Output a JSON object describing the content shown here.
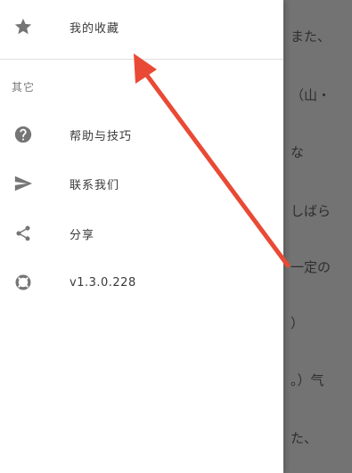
{
  "drawer": {
    "favorites_label": "我的收藏",
    "section_other": "其它",
    "items": [
      {
        "label": "帮助与技巧",
        "icon": "help-circle-icon"
      },
      {
        "label": "联系我们",
        "icon": "send-icon"
      },
      {
        "label": "分享",
        "icon": "share-icon"
      },
      {
        "label": "v1.3.0.228",
        "icon": "lifebuoy-icon"
      }
    ]
  },
  "background_text": [
    "また、",
    "（山・",
    "な",
    "しばら",
    "一定の",
    "）",
    "。）气",
    "た、"
  ],
  "colors": {
    "annotation_arrow": "#e94a35",
    "icon_gray": "#757575",
    "scrim": "#737373"
  }
}
